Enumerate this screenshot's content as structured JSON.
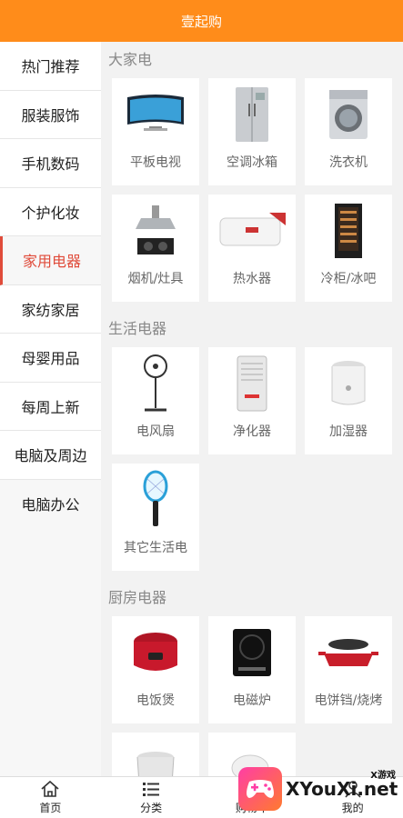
{
  "header": {
    "title": "壹起购"
  },
  "sidebar": {
    "items": [
      {
        "label": "热门推荐"
      },
      {
        "label": "服装服饰"
      },
      {
        "label": "手机数码"
      },
      {
        "label": "个护化妆"
      },
      {
        "label": "家用电器",
        "active": true
      },
      {
        "label": "家纺家居"
      },
      {
        "label": "母婴用品"
      },
      {
        "label": "每周上新"
      },
      {
        "label": "电脑及周边"
      },
      {
        "label": "电脑办公"
      }
    ]
  },
  "sections": [
    {
      "title": "大家电",
      "items": [
        {
          "label": "平板电视",
          "icon": "tv-icon"
        },
        {
          "label": "空调冰箱",
          "icon": "fridge-icon"
        },
        {
          "label": "洗衣机",
          "icon": "washer-icon"
        },
        {
          "label": "烟机/灶具",
          "icon": "range-hood-icon"
        },
        {
          "label": "热水器",
          "icon": "water-heater-icon"
        },
        {
          "label": "冷柜/冰吧",
          "icon": "wine-fridge-icon"
        }
      ]
    },
    {
      "title": "生活电器",
      "items": [
        {
          "label": "电风扇",
          "icon": "fan-icon"
        },
        {
          "label": "净化器",
          "icon": "purifier-icon"
        },
        {
          "label": "加湿器",
          "icon": "humidifier-icon"
        },
        {
          "label": "其它生活电",
          "icon": "bug-zapper-icon"
        }
      ]
    },
    {
      "title": "厨房电器",
      "items": [
        {
          "label": "电饭煲",
          "icon": "rice-cooker-icon"
        },
        {
          "label": "电磁炉",
          "icon": "induction-cooker-icon"
        },
        {
          "label": "电饼铛/烧烤",
          "icon": "grill-icon"
        },
        {
          "label": "",
          "icon": "pot-icon"
        },
        {
          "label": "",
          "icon": "steamer-icon"
        }
      ]
    }
  ],
  "tabbar": {
    "items": [
      {
        "label": "首页",
        "icon": "home-icon"
      },
      {
        "label": "分类",
        "icon": "list-icon"
      },
      {
        "label": "购物车",
        "icon": "cart-icon"
      },
      {
        "label": "我的",
        "icon": "user-icon"
      }
    ]
  },
  "watermark": {
    "text": "XYouXi.net",
    "small": "X游戏"
  }
}
